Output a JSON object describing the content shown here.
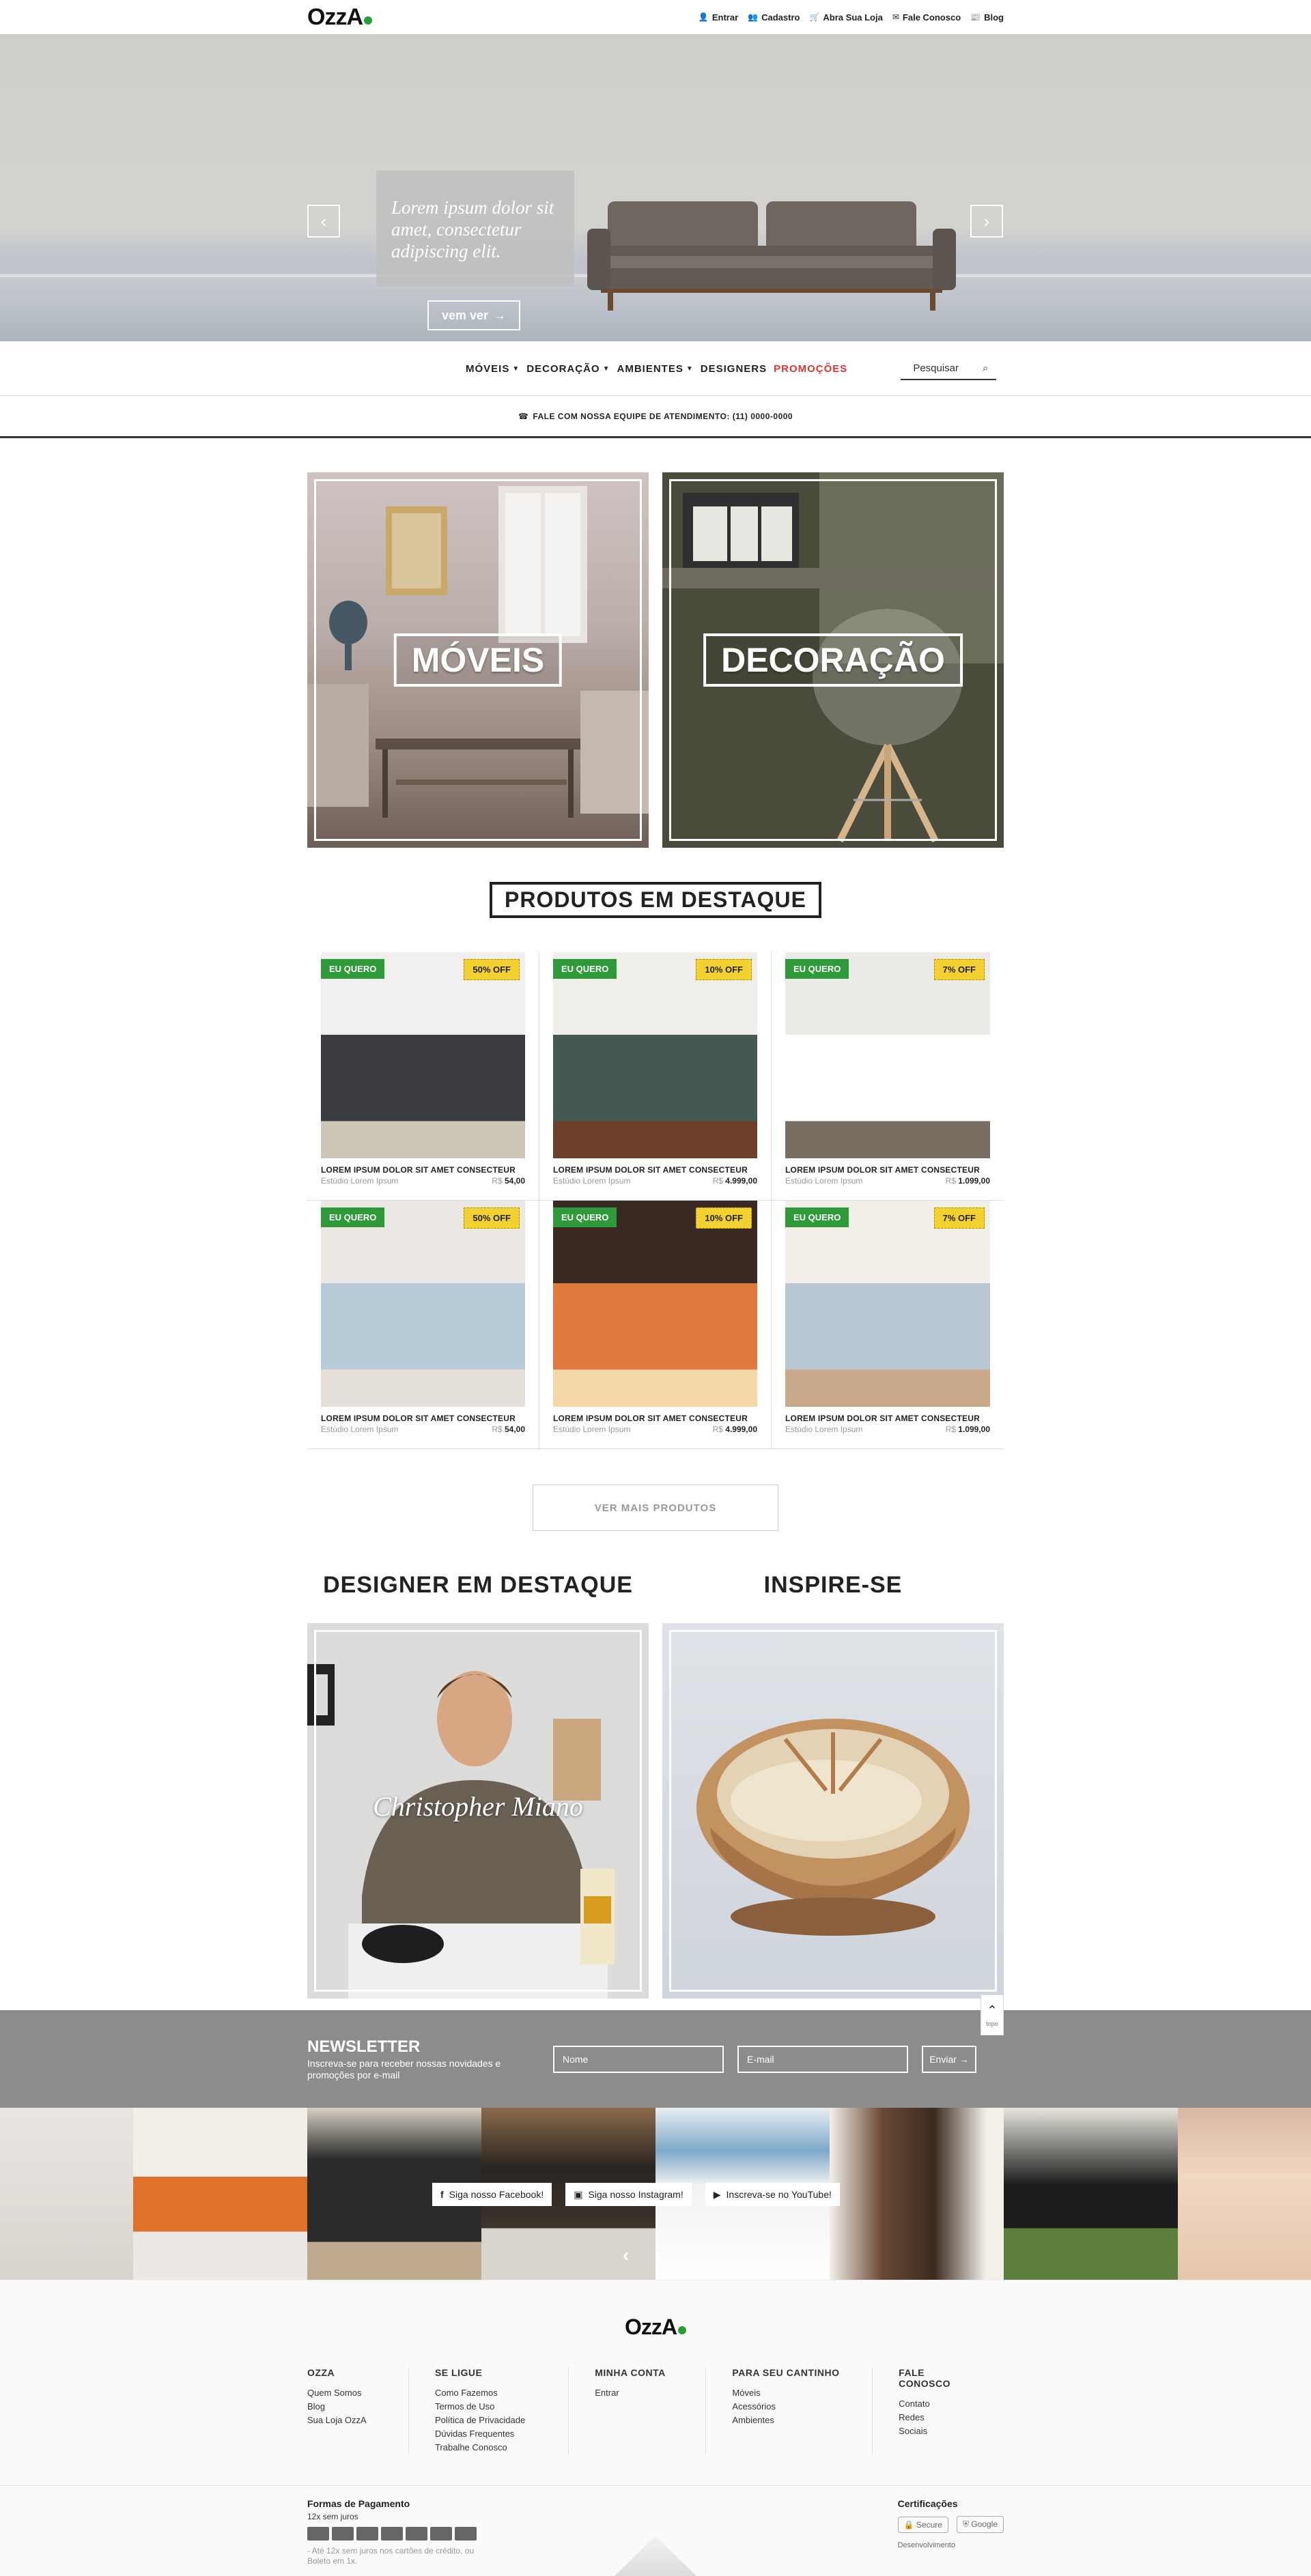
{
  "header": {
    "logo": "OzzA",
    "links": [
      {
        "label": "Entrar",
        "icon": "user-icon"
      },
      {
        "label": "Cadastro",
        "icon": "user-plus-icon"
      },
      {
        "label": "Abra Sua Loja",
        "icon": "cart-icon"
      },
      {
        "label": "Fale Conosco",
        "icon": "mail-icon"
      },
      {
        "label": "Blog",
        "icon": "blog-icon"
      }
    ]
  },
  "hero": {
    "caption": "Lorem ipsum dolor sit amet, consectetur adipiscing elit.",
    "button": "vem ver",
    "slides": 3,
    "active_slide": 3
  },
  "nav": {
    "items": [
      "MÓVEIS",
      "DECORAÇÃO",
      "AMBIENTES",
      "DESIGNERS",
      "PROMOÇÕES"
    ],
    "search_placeholder": "Pesquisar"
  },
  "callbar": {
    "text": "FALE COM NOSSA EQUIPE DE ATENDIMENTO: (11) 0000-0000"
  },
  "categories": {
    "moveis": "MÓVEIS",
    "decoracao": "DECORAÇÃO"
  },
  "featured": {
    "title": "PRODUTOS EM DESTAQUE",
    "products": [
      {
        "want": "EU QUERO",
        "off": "50% OFF",
        "name": "LOREM IPSUM DOLOR SIT AMET CONSECTEUR",
        "studio": "Estúdio Lorem Ipsum",
        "currency": "R$",
        "price": "54,00"
      },
      {
        "want": "EU QUERO",
        "off": "10% OFF",
        "name": "LOREM IPSUM DOLOR SIT AMET CONSECTEUR",
        "studio": "Estúdio Lorem Ipsum",
        "currency": "R$",
        "price": "4.999,00"
      },
      {
        "want": "EU QUERO",
        "off": "7% OFF",
        "name": "LOREM IPSUM DOLOR SIT AMET CONSECTEUR",
        "studio": "Estúdio Lorem Ipsum",
        "currency": "R$",
        "price": "1.099,00"
      },
      {
        "want": "EU QUERO",
        "off": "50% OFF",
        "name": "LOREM IPSUM DOLOR SIT AMET CONSECTEUR",
        "studio": "Estúdio Lorem Ipsum",
        "currency": "R$",
        "price": "54,00"
      },
      {
        "want": "EU QUERO",
        "off": "10% OFF",
        "name": "LOREM IPSUM DOLOR SIT AMET CONSECTEUR",
        "studio": "Estúdio Lorem Ipsum",
        "currency": "R$",
        "price": "4.999,00"
      },
      {
        "want": "EU QUERO",
        "off": "7% OFF",
        "name": "LOREM IPSUM DOLOR SIT AMET CONSECTEUR",
        "studio": "Estúdio Lorem Ipsum",
        "currency": "R$",
        "price": "1.099,00"
      }
    ],
    "more_button": "VER MAIS PRODUTOS"
  },
  "designer": {
    "heading": "DESIGNER EM DESTAQUE",
    "name": "Christopher Miano"
  },
  "inspire": {
    "heading": "INSPIRE-SE"
  },
  "back_to_top": "topo",
  "newsletter": {
    "title": "NEWSLETTER",
    "subtitle": "Inscreva-se para receber nossas novidades e promoções por e-mail",
    "name_placeholder": "Nome",
    "email_placeholder": "E-mail",
    "button": "Enviar"
  },
  "social": {
    "facebook": "Siga nosso Facebook!",
    "instagram": "Siga nosso Instagram!",
    "youtube": "Inscreva-se no YouTube!"
  },
  "footer": {
    "logo": "OzzA",
    "columns": [
      {
        "title": "OZZA",
        "links": [
          "Quem Somos",
          "Blog",
          "Sua Loja OzzA"
        ]
      },
      {
        "title": "SE LIGUE",
        "links": [
          "Como Fazemos",
          "Termos de Uso",
          "Política de Privacidade",
          "Dúvidas Frequentes",
          "Trabalhe Conosco"
        ]
      },
      {
        "title": "MINHA CONTA",
        "links": [
          "Entrar"
        ]
      },
      {
        "title": "PARA SEU CANTINHO",
        "links": [
          "Móveis",
          "Acessórios",
          "Ambientes"
        ]
      },
      {
        "title": "FALE CONOSCO",
        "links": [
          "Contato",
          "Redes Sociais"
        ]
      }
    ],
    "payment_title": "Formas de Pagamento",
    "payment_sub": "12x sem juros",
    "payment_note": "- Até 12x sem juros nos cartões de crédito, ou Boleto em 1x.",
    "cert_title": "Certificações",
    "cert_secure": "Secure",
    "cert_google": "Google",
    "developed": "Desenvolvimento"
  },
  "colors": {
    "accent_green": "#2f9a3a",
    "promo_red": "#e3342f",
    "badge_yellow": "#f3d131",
    "newsletter_bg": "#8c8c8c"
  }
}
